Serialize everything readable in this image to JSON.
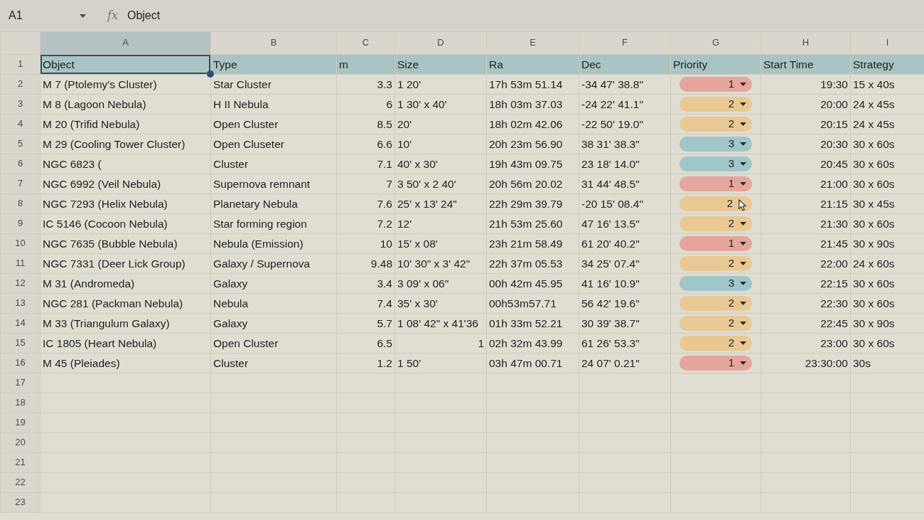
{
  "formula_bar": {
    "cell_name": "A1",
    "function_symbol": "fx",
    "content": "Object"
  },
  "sheet": {
    "columns": [
      {
        "letter": "A",
        "selected": true
      },
      {
        "letter": "B",
        "selected": false
      },
      {
        "letter": "C",
        "selected": false
      },
      {
        "letter": "D",
        "selected": false
      },
      {
        "letter": "E",
        "selected": false
      },
      {
        "letter": "F",
        "selected": false
      },
      {
        "letter": "G",
        "selected": false
      },
      {
        "letter": "H",
        "selected": false
      },
      {
        "letter": "I",
        "selected": false
      }
    ],
    "header_row": {
      "number": "1",
      "cells": [
        "Object",
        "Type",
        "m",
        "Size",
        "Ra",
        "Dec",
        "Priority",
        "Start Time",
        "Strategy"
      ]
    },
    "rows": [
      {
        "number": "2",
        "object": "M 7 (Ptolemy's Cluster)",
        "type": "Star Cluster",
        "m": "3.3",
        "size": {
          "text": "1 20'",
          "kind": "text"
        },
        "ra": "17h 53m 51.14",
        "dec": "-34 47' 38.8\"",
        "priority": {
          "value": "1",
          "color": "#e5a69d"
        },
        "hovered": false,
        "start_time": "19:30",
        "strategy": "15 x 40s"
      },
      {
        "number": "3",
        "object": "M 8 (Lagoon Nebula)",
        "type": "H II Nebula",
        "m": "6",
        "size": {
          "text": "1 30' x 40'",
          "kind": "text"
        },
        "ra": "18h 03m 37.03",
        "dec": "-24 22' 41.1\"",
        "priority": {
          "value": "2",
          "color": "#e9c893"
        },
        "hovered": false,
        "start_time": "20:00",
        "strategy": "24 x 45s"
      },
      {
        "number": "4",
        "object": "M 20 (Trifid Nebula)",
        "type": "Open Cluster",
        "m": "8.5",
        "size": {
          "text": "20'",
          "kind": "text"
        },
        "ra": "18h 02m 42.06",
        "dec": "-22 50' 19.0\"",
        "priority": {
          "value": "2",
          "color": "#e9c893"
        },
        "hovered": false,
        "start_time": "20:15",
        "strategy": "24 x 45s"
      },
      {
        "number": "5",
        "object": "M 29 (Cooling Tower Cluster)",
        "type": "Open Cluseter",
        "m": "6.6",
        "size": {
          "text": "10'",
          "kind": "text"
        },
        "ra": "20h 23m 56.90",
        "dec": "38 31' 38.3\"",
        "priority": {
          "value": "3",
          "color": "#9fc6c8"
        },
        "hovered": false,
        "start_time": "20:30",
        "strategy": "30 x 60s"
      },
      {
        "number": "6",
        "object": "NGC 6823 (",
        "type": "Cluster",
        "m": "7.1",
        "size": {
          "text": "40' x 30'",
          "kind": "text"
        },
        "ra": "19h 43m 09.75",
        "dec": "23 18' 14.0\"",
        "priority": {
          "value": "3",
          "color": "#9fc6c8"
        },
        "hovered": false,
        "start_time": "20:45",
        "strategy": "30 x 60s"
      },
      {
        "number": "7",
        "object": "NGC 6992 (Veil Nebula)",
        "type": "Supernova remnant",
        "m": "7",
        "size": {
          "text": "3 50' x 2 40'",
          "kind": "text"
        },
        "ra": "20h 56m 20.02",
        "dec": "31 44' 48.5\"",
        "priority": {
          "value": "1",
          "color": "#e5a69d"
        },
        "hovered": false,
        "start_time": "21:00",
        "strategy": "30 x 60s"
      },
      {
        "number": "8",
        "object": "NGC 7293 (Helix Nebula)",
        "type": "Planetary Nebula",
        "m": "7.6",
        "size": {
          "text": "25' x 13' 24\"",
          "kind": "text"
        },
        "ra": "22h 29m 39.79",
        "dec": "-20 15' 08.4\"",
        "priority": {
          "value": "2",
          "color": "#e9c893"
        },
        "hovered": true,
        "start_time": "21:15",
        "strategy": "30 x 45s"
      },
      {
        "number": "9",
        "object": "IC 5146 (Cocoon Nebula)",
        "type": "Star forming region",
        "m": "7.2",
        "size": {
          "text": "12'",
          "kind": "text"
        },
        "ra": "21h 53m 25.60",
        "dec": "47 16' 13.5\"",
        "priority": {
          "value": "2",
          "color": "#e9c893"
        },
        "hovered": false,
        "start_time": "21:30",
        "strategy": "30 x 60s"
      },
      {
        "number": "10",
        "object": "NGC 7635 (Bubble Nebula)",
        "type": "Nebula (Emission)",
        "m": "10",
        "size": {
          "text": "15' x 08'",
          "kind": "text"
        },
        "ra": "23h 21m 58.49",
        "dec": "61 20' 40.2\"",
        "priority": {
          "value": "1",
          "color": "#e5a69d"
        },
        "hovered": false,
        "start_time": "21:45",
        "strategy": "30 x 90s"
      },
      {
        "number": "11",
        "object": "NGC 7331 (Deer Lick Group)",
        "type": "Galaxy / Supernova",
        "m": "9.48",
        "size": {
          "text": "10' 30\" x 3' 42\"",
          "kind": "text"
        },
        "ra": "22h 37m 05.53",
        "dec": "34 25' 07.4\"",
        "priority": {
          "value": "2",
          "color": "#e9c893"
        },
        "hovered": false,
        "start_time": "22:00",
        "strategy": "24 x 60s"
      },
      {
        "number": "12",
        "object": "M 31 (Andromeda)",
        "type": "Galaxy",
        "m": "3.4",
        "size": {
          "text": "3 09' x 06\"",
          "kind": "text"
        },
        "ra": "00h 42m 45.95",
        "dec": "41 16' 10.9\"",
        "priority": {
          "value": "3",
          "color": "#9fc6c8"
        },
        "hovered": false,
        "start_time": "22:15",
        "strategy": "30 x 60s"
      },
      {
        "number": "13",
        "object": "NGC 281 (Packman Nebula)",
        "type": "Nebula",
        "m": "7.4",
        "size": {
          "text": "35' x 30'",
          "kind": "text"
        },
        "ra": "00h53m57.71",
        "dec": "56 42' 19.6\"",
        "priority": {
          "value": "2",
          "color": "#e9c893"
        },
        "hovered": false,
        "start_time": "22:30",
        "strategy": "30 x 60s"
      },
      {
        "number": "14",
        "object": "M 33 (Triangulum Galaxy)",
        "type": "Galaxy",
        "m": "5.7",
        "size": {
          "text": "1 08' 42\" x 41'36",
          "kind": "text"
        },
        "ra": "01h 33m 52.21",
        "dec": "30 39' 38.7\"",
        "priority": {
          "value": "2",
          "color": "#e9c893"
        },
        "hovered": false,
        "start_time": "22:45",
        "strategy": "30 x 90s"
      },
      {
        "number": "15",
        "object": "IC 1805 (Heart Nebula)",
        "type": "Open Cluster",
        "m": "6.5",
        "size": {
          "text": "1",
          "kind": "number"
        },
        "ra": "02h 32m 43.99",
        "dec": "61 26' 53.3\"",
        "priority": {
          "value": "2",
          "color": "#e9c893"
        },
        "hovered": false,
        "start_time": "23:00",
        "strategy": "30 x 60s"
      },
      {
        "number": "16",
        "object": "M 45 (Pleiades)",
        "type": "Cluster",
        "m": "1.2",
        "size": {
          "text": "1 50'",
          "kind": "text"
        },
        "ra": "03h 47m 00.71",
        "dec": "24 07' 0.21\"",
        "priority": {
          "value": "1",
          "color": "#e5a69d"
        },
        "hovered": false,
        "start_time": "23:30:00",
        "strategy": "30s"
      }
    ],
    "empty_rows": [
      "17",
      "18",
      "19",
      "20",
      "21",
      "22",
      "23"
    ]
  }
}
